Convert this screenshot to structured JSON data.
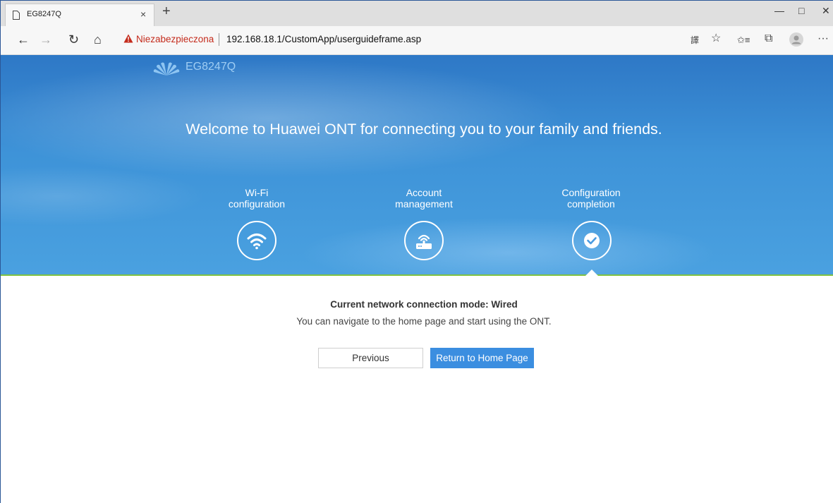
{
  "browser": {
    "tab_title": "EG8247Q",
    "tab_close": "×",
    "new_tab": "+",
    "minimize": "—",
    "maximize": "□",
    "close": "✕",
    "back": "←",
    "forward": "→",
    "refresh": "↻",
    "home": "⌂",
    "security_warning": "Niezabezpieczona",
    "url": "192.168.18.1/CustomApp/userguideframe.asp",
    "tools": {
      "translate": "譯",
      "favorite": "☆",
      "favorites_list": "✩≡",
      "collections": "⧉",
      "more": "···"
    }
  },
  "header": {
    "brand": "EG8247Q",
    "welcome": "Welcome to Huawei ONT for connecting you to your family and friends."
  },
  "steps": [
    {
      "line1": "Wi-Fi",
      "line2": "configuration",
      "icon": "wifi-icon"
    },
    {
      "line1": "Account",
      "line2": "management",
      "icon": "router-icon"
    },
    {
      "line1": "Configuration",
      "line2": "completion",
      "icon": "check-icon",
      "active": true
    }
  ],
  "content": {
    "mode_text": "Current network connection mode: Wired",
    "info_text": "You can navigate to the home page and start using the ONT.",
    "previous_label": "Previous",
    "home_label": "Return to Home Page"
  },
  "colors": {
    "accent": "#3b8ee0",
    "hero": "#3e93d8",
    "progress_line": "#7fc242",
    "warning": "#c42b1c"
  }
}
